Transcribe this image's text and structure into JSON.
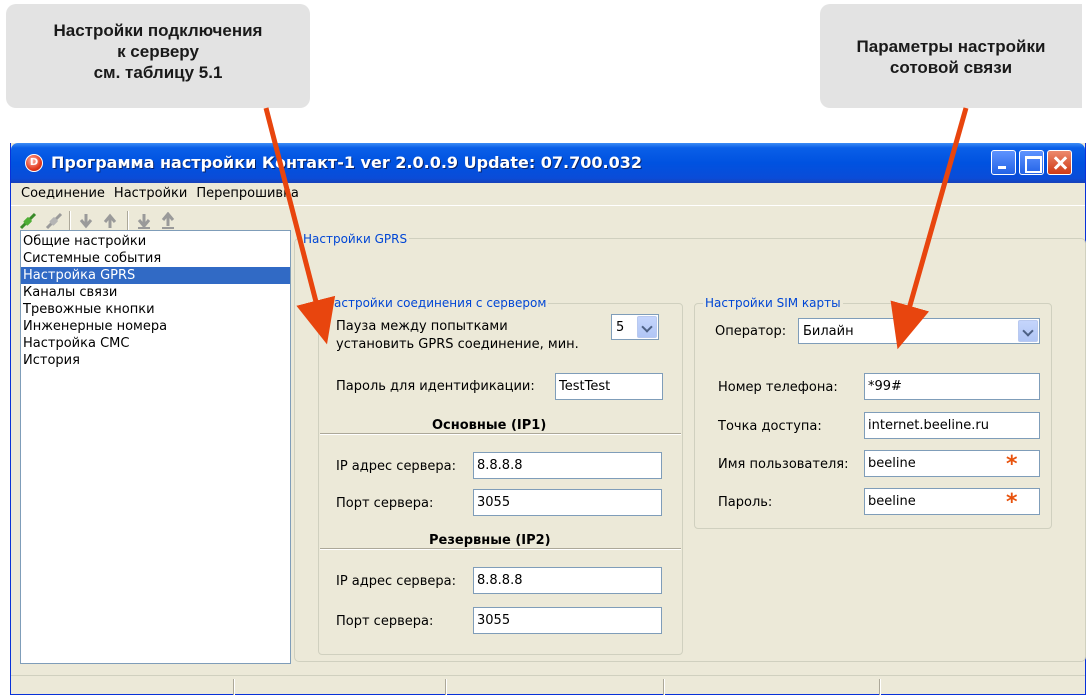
{
  "callouts": {
    "left": {
      "line1": "Настройки подключения",
      "line2": "к серверу",
      "line3": "см. таблицу 5.1"
    },
    "right": {
      "line1": "Параметры настройки",
      "line2": "сотовой связи"
    }
  },
  "window": {
    "title": "Программа настройки Контакт-1 ver 2.0.0.9 Update: 07.700.032",
    "icon_letter": "D"
  },
  "menu": [
    "Соединение",
    "Настройки",
    "Перепрошивка"
  ],
  "toolbar_icons": [
    "connect-icon",
    "disconnect-icon",
    "download-icon",
    "upload-icon",
    "download-file-icon",
    "upload-file-icon"
  ],
  "tree": {
    "items": [
      "Общие настройки",
      "Системные события",
      "Настройка GPRS",
      "Каналы связи",
      "Тревожные кнопки",
      "Инженерные номера",
      "Настройка СМС",
      "История"
    ],
    "selected_index": 2
  },
  "gprs": {
    "panel_title": "Настройки GPRS",
    "server": {
      "title": "Настройки соединения с сервером",
      "pause_label_1": "Пауза между попытками",
      "pause_label_2": "установить GPRS соединение, мин.",
      "pause_value": "5",
      "password_label": "Пароль для идентификации:",
      "password_value": "TestTest",
      "primary_heading": "Основные (IP1)",
      "primary_ip_label": "IP адрес сервера:",
      "primary_ip_value": "8.8.8.8",
      "primary_port_label": "Порт сервера:",
      "primary_port_value": "3055",
      "backup_heading": "Резервные (IP2)",
      "backup_ip_label": "IP адрес сервера:",
      "backup_ip_value": "8.8.8.8",
      "backup_port_label": "Порт сервера:",
      "backup_port_value": "3055"
    },
    "sim": {
      "title": "Настройки SIM карты",
      "operator_label": "Оператор:",
      "operator_value": "Билайн",
      "phone_label": "Номер телефона:",
      "phone_value": "*99#",
      "apn_label": "Точка доступа:",
      "apn_value": "internet.beeline.ru",
      "user_label": "Имя пользователя:",
      "user_value": "beeline",
      "pass_label": "Пароль:",
      "pass_value": "beeline",
      "required_mark": "*"
    }
  },
  "colors": {
    "accent": "#0046d5",
    "selection": "#316ac5",
    "arrow": "#e8450e",
    "required": "#e8520c"
  }
}
